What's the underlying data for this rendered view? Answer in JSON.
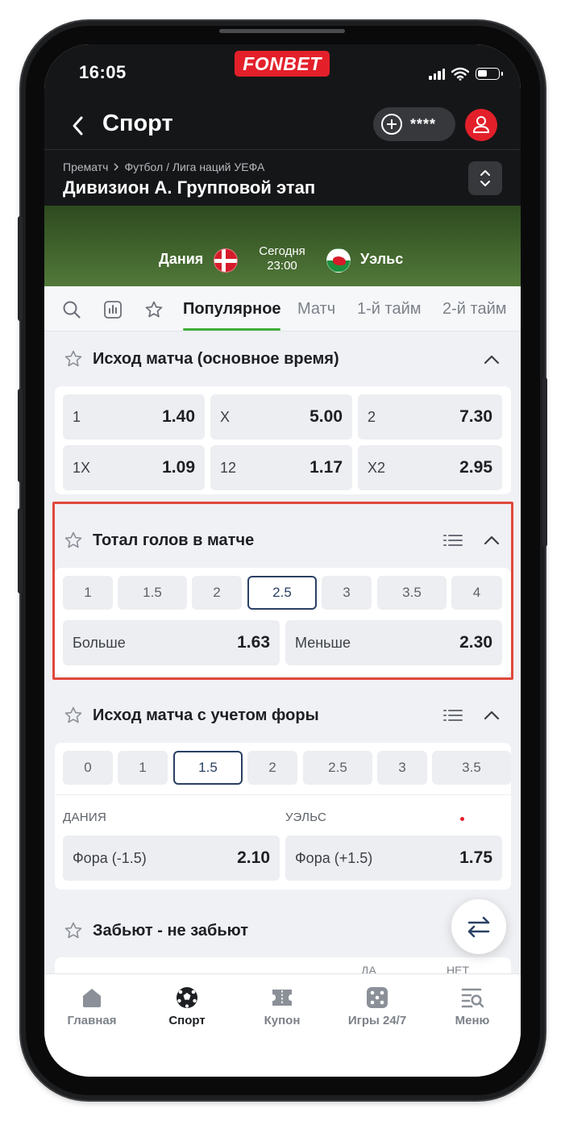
{
  "status": {
    "time": "16:05",
    "logo": "FONBET"
  },
  "header": {
    "title": "Спорт",
    "balance_masked": "****",
    "breadcrumb": [
      "Прематч",
      "Футбол / Лига наций УЕФА"
    ],
    "league_title": "Дивизион А. Групповой этап"
  },
  "match": {
    "home": "Дания",
    "away": "Уэльс",
    "date": "Сегодня",
    "time": "23:00"
  },
  "tabs": [
    "Популярное",
    "Матч",
    "1-й тайм",
    "2-й тайм"
  ],
  "active_tab": "Популярное",
  "markets": {
    "outcome": {
      "title": "Исход матча (основное время)",
      "odds": [
        {
          "label": "1",
          "value": "1.40"
        },
        {
          "label": "X",
          "value": "5.00"
        },
        {
          "label": "2",
          "value": "7.30"
        },
        {
          "label": "1X",
          "value": "1.09"
        },
        {
          "label": "12",
          "value": "1.17"
        },
        {
          "label": "X2",
          "value": "2.95"
        }
      ]
    },
    "total": {
      "title": "Тотал голов в матче",
      "lines": [
        "1",
        "1.5",
        "2",
        "2.5",
        "3",
        "3.5",
        "4"
      ],
      "selected_line": "2.5",
      "odds": [
        {
          "label": "Больше",
          "value": "1.63"
        },
        {
          "label": "Меньше",
          "value": "2.30"
        }
      ]
    },
    "handicap": {
      "title": "Исход матча с учетом форы",
      "lines": [
        "0",
        "1",
        "1.5",
        "2",
        "2.5",
        "3",
        "3.5"
      ],
      "selected_line": "1.5",
      "col_home": "ДАНИЯ",
      "col_away": "УЭЛЬС",
      "odds": [
        {
          "label": "Фора (-1.5)",
          "value": "2.10"
        },
        {
          "label": "Фора (+1.5)",
          "value": "1.75"
        }
      ]
    },
    "score": {
      "title": "Забьют - не забьют",
      "col_yes": "ДА",
      "col_no": "НЕТ"
    }
  },
  "bottom_nav": [
    {
      "label": "Главная",
      "icon": "home-icon"
    },
    {
      "label": "Спорт",
      "icon": "soccer-ball-icon"
    },
    {
      "label": "Купон",
      "icon": "coupon-icon"
    },
    {
      "label": "Игры 24/7",
      "icon": "dice-icon"
    },
    {
      "label": "Меню",
      "icon": "menu-search-icon"
    }
  ],
  "colors": {
    "brand_red": "#e3202a",
    "accent_green": "#3fae3a",
    "selected_navy": "#2a4064",
    "highlight": "#e0483c"
  }
}
